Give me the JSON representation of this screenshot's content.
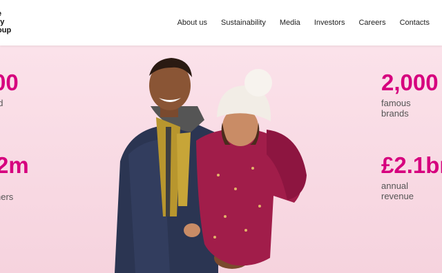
{
  "logo": {
    "line1": "e",
    "line2": "ry",
    "line3": "oup"
  },
  "nav": [
    "About us",
    "Sustainability",
    "Media",
    "Investors",
    "Careers",
    "Contacts"
  ],
  "stats_left": [
    {
      "value": "00",
      "desc1": "ed",
      "desc2": ""
    },
    {
      "value": "2m",
      "desc1": "",
      "desc2": "ners"
    }
  ],
  "stats_right": [
    {
      "value": "2,000",
      "desc1": "famous",
      "desc2": "brands"
    },
    {
      "value": "£2.1br",
      "desc1": "annual",
      "desc2": "revenue"
    }
  ],
  "colors": {
    "accent": "#d6007e",
    "hero_bg": "#f9dde6",
    "coat_red": "#a11d4a",
    "jacket_navy": "#2b3552"
  }
}
